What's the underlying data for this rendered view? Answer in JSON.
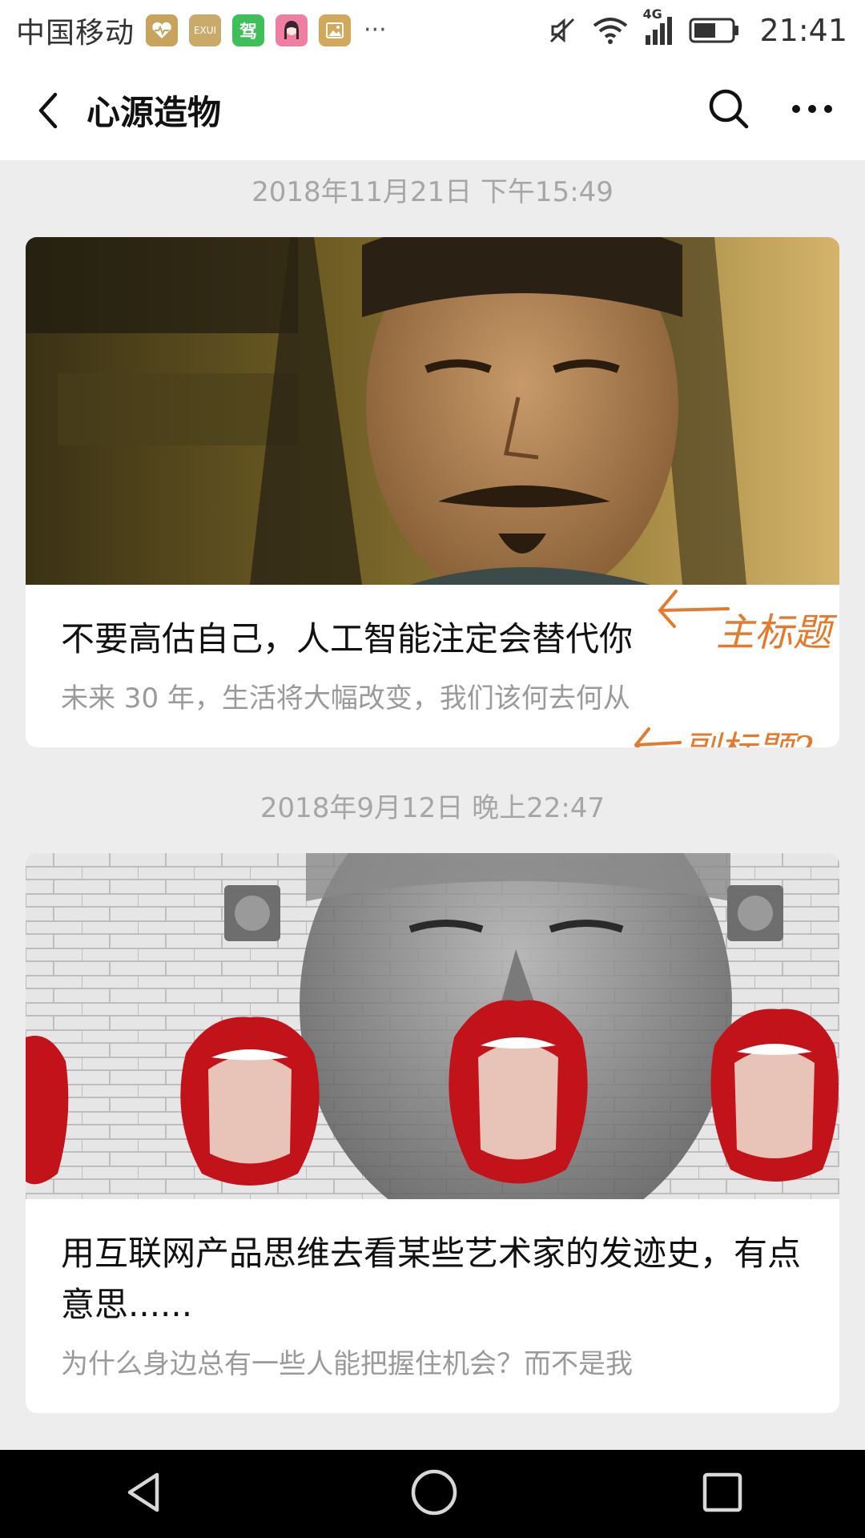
{
  "status_bar": {
    "carrier": "中国移动",
    "notification_icons": [
      "health-icon",
      "exui-icon",
      "driving-icon",
      "girl-icon",
      "gallery-icon"
    ],
    "notification_text": {
      "exui": "EXUI",
      "drive": "驾",
      "more": "···"
    },
    "network": "4G",
    "time": "21:41"
  },
  "header": {
    "title": "心源造物"
  },
  "articles": [
    {
      "date": "2018年11月21日 下午15:49",
      "title": "不要高估自己，人工智能注定会替代你",
      "subtitle": "未来 30 年，生活将大幅改变，我们该何去何从",
      "annotations": {
        "title_note": "主标题",
        "subtitle_note": "副标题?"
      }
    },
    {
      "date": "2018年9月12日 晚上22:47",
      "title": "用互联网产品思维去看某些艺术家的发迹史，有点意思......",
      "subtitle": "为什么身边总有一些人能把握住机会？而不是我"
    }
  ],
  "colors": {
    "background": "#ededed",
    "date_text": "#a6a6a6",
    "annotation": "#e27b2e",
    "lips_red": "#c2121a"
  }
}
